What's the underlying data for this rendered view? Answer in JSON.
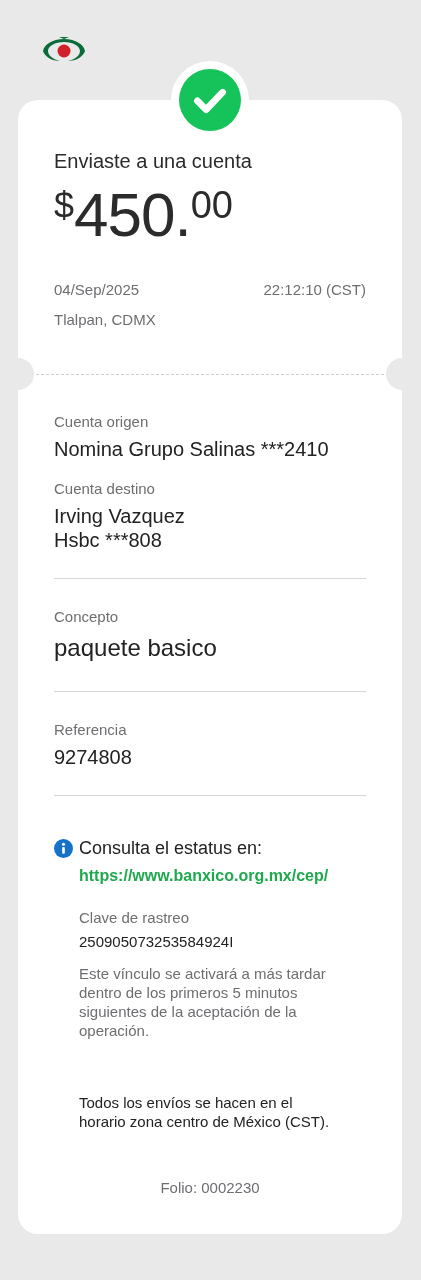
{
  "header": {
    "completed": true
  },
  "receipt": {
    "title": "Enviaste a una cuenta",
    "amount": {
      "currency": "$",
      "integer": "450.",
      "decimals": "00"
    },
    "date": "04/Sep/2025",
    "time": "22:12:10 (CST)",
    "location": "Tlalpan, CDMX"
  },
  "details": [
    {
      "kind": "accounts",
      "items": [
        {
          "label": "Cuenta origen",
          "lines": [
            "Nomina Grupo Salinas ***2410"
          ]
        },
        {
          "label": "Cuenta destino",
          "lines": [
            "Irving Vazquez",
            "Hsbc ***808"
          ]
        }
      ]
    },
    {
      "kind": "concept",
      "items": [
        {
          "label": "Concepto",
          "lines": [
            "paquete basico"
          ]
        }
      ]
    },
    {
      "kind": "reference",
      "items": [
        {
          "label": "Referencia",
          "lines": [
            "9274808"
          ]
        }
      ]
    }
  ],
  "info": {
    "heading": "Consulta el estatus en:",
    "link": "https://www.banxico.org.mx/cep/",
    "tracking_label": "Clave de rastreo",
    "tracking_value": "250905073253584924I",
    "note": "Este vínculo se activará a más tardar dentro de los primeros 5 minutos siguientes de la aceptación de la operación."
  },
  "footer_note": "Todos los envíos se hacen en el horario zona centro de México (CST).",
  "folio": "Folio: 0002230"
}
